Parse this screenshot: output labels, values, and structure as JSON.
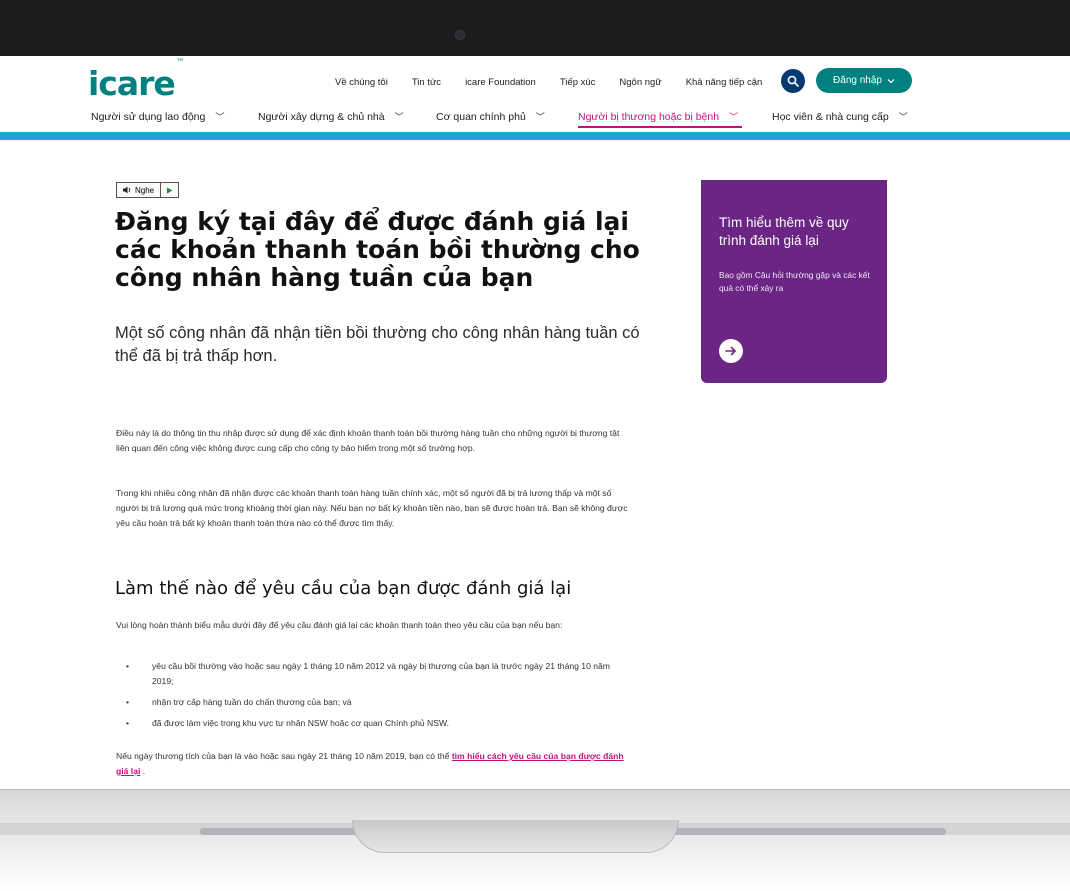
{
  "header": {
    "logo_text": "icare",
    "logo_tm": "™",
    "top_links": [
      "Về chúng tôi",
      "Tin tức",
      "icare Foundation",
      "Tiếp xúc",
      "Ngôn ngữ",
      "Khả năng tiếp cận"
    ],
    "login_label": "Đăng nhập",
    "search_icon": "search-icon"
  },
  "main_nav": {
    "items": [
      {
        "label": "Người sử dụng lao động",
        "active": false
      },
      {
        "label": "Người xây dựng & chủ nhà",
        "active": false
      },
      {
        "label": "Cơ quan chính phủ",
        "active": false
      },
      {
        "label": "Người bị thương hoặc bị bệnh",
        "active": true
      },
      {
        "label": "Học viên & nhà cung cấp",
        "active": false
      }
    ]
  },
  "listen": {
    "label": "Nghe"
  },
  "content": {
    "title": "Đăng ký tại đây để được đánh giá lại các khoản thanh toán bồi thường cho công nhân hàng tuần của bạn",
    "lead": "Một số công nhân đã nhận tiền bồi thường cho công nhân hàng tuần có thể đã bị trả thấp hơn.",
    "para1": "Điều này là do thông tin thu nhập được sử dụng để xác định khoản thanh toán bồi thường hàng tuần cho những người bị thương tật liên quan đến công việc không được cung cấp cho công ty bảo hiểm trong một số trường hợp.",
    "para2": "Trong khi nhiều công nhân đã nhận được các khoản thanh toán hàng tuần chính xác, một số người đã bị trả lương thấp và một số người bị trả lương quá mức trong khoảng thời gian này. Nếu bạn nợ bất kỳ khoản tiền nào, bạn sẽ được hoàn trả. Bạn sẽ không được yêu cầu hoàn trả bất kỳ khoản thanh toán thừa nào có thể được tìm thấy.",
    "heading2": "Làm thế nào để yêu cầu của bạn được đánh giá lại",
    "para3": "Vui lòng hoàn thành biểu mẫu dưới đây để yêu cầu đánh giá lại các khoản thanh toán theo yêu cầu của bạn nếu bạn:",
    "bullets": [
      "yêu cầu bồi thường vào hoặc sau ngày 1 tháng 10 năm 2012 và ngày bị thương của bạn là trước ngày 21 tháng 10 năm 2019;",
      "nhận trợ cấp hàng tuần do chấn thương của bạn; và",
      "đã được làm việc trong khu vực tư nhân NSW hoặc cơ quan Chính phủ NSW."
    ],
    "final_text": "Nếu ngày thương tích của bạn là vào hoặc sau ngày 21 tháng 10 năm 2019, bạn có thể ",
    "final_link": "tìm hiểu cách yêu cầu của bạn được đánh giá lại",
    "final_end": " ."
  },
  "card": {
    "title": "Tìm hiểu thêm về quy trình đánh giá lại",
    "text": "Bao gồm Câu hỏi thường gặp và các kết quả có thể xảy ra",
    "color": "#6b2585"
  },
  "colors": {
    "brand": "#00807f",
    "accent_bar": "#1fa2d6",
    "active_nav": "#c8107d",
    "search_bg": "#003a70"
  }
}
